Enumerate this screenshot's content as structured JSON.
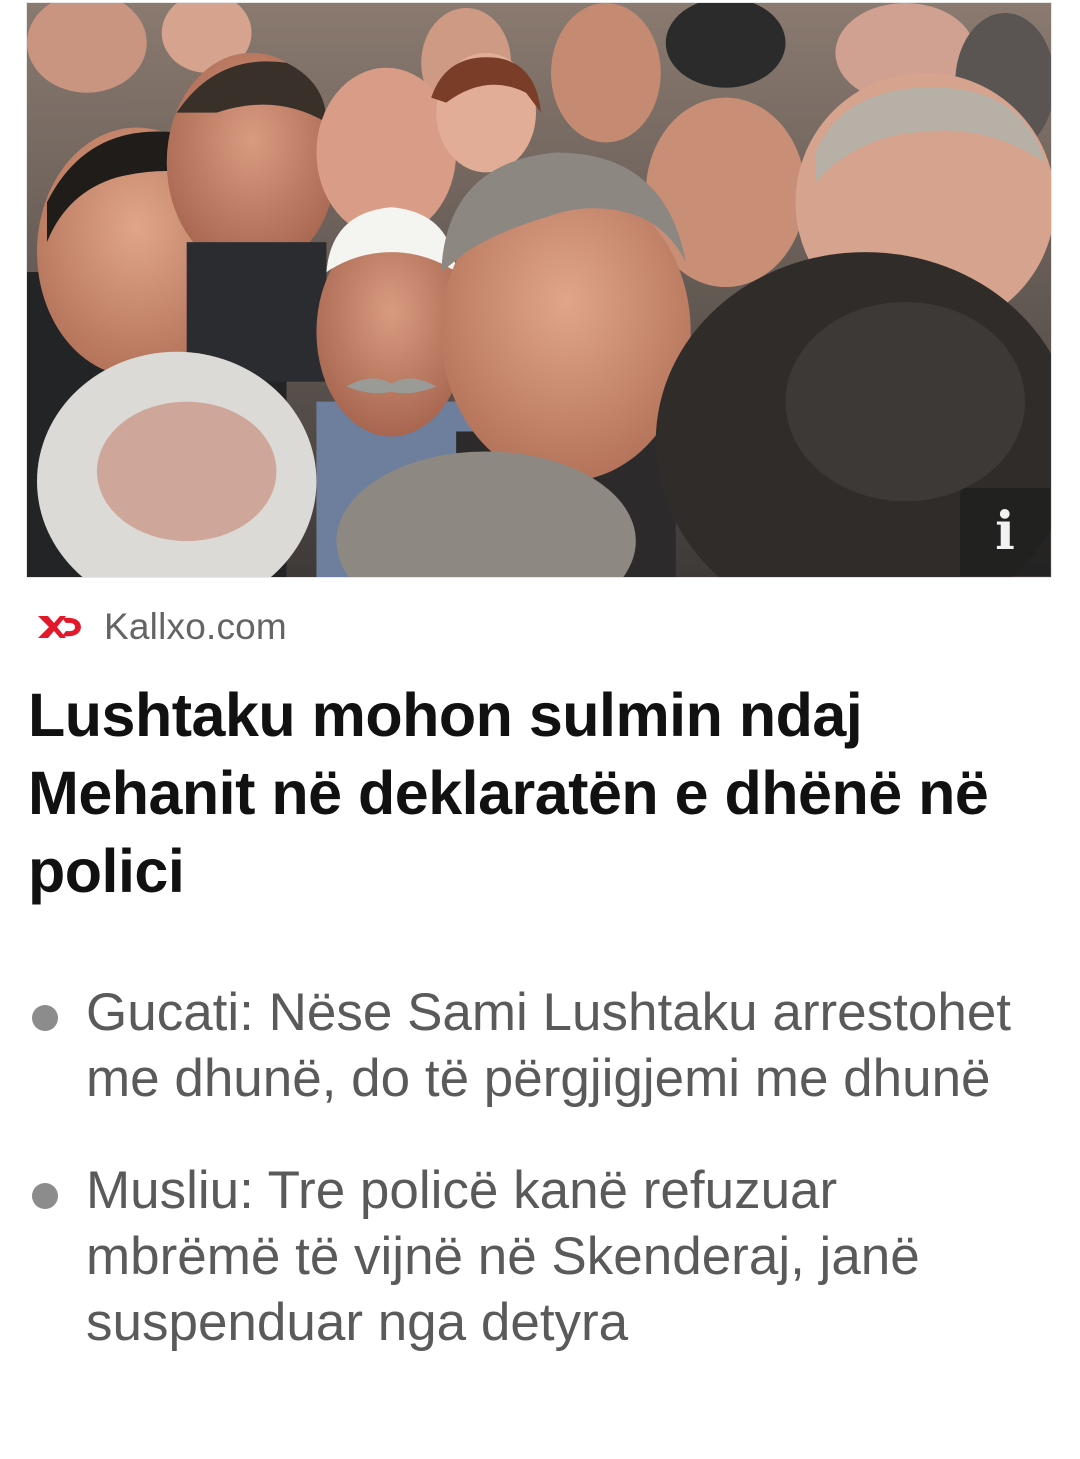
{
  "article": {
    "image_alt": "",
    "info_label": "i",
    "source": {
      "logo_icon": "kallxo-logo-icon",
      "name": "Kallxo.com",
      "brand_color": "#e3192b"
    },
    "headline": "Lushtaku mohon sulmin ndaj Mehanit në deklaratën e dhënë në polici"
  },
  "related_stories": [
    {
      "text": "Gucati: Nëse Sami Lushtaku arrestohet me dhunë, do të përgjigjemi me dhunë"
    },
    {
      "text": "Musliu: Tre policë kanë refuzuar mbrëmë të vijnë në Skenderaj, janë suspenduar nga detyra"
    }
  ],
  "colors": {
    "headline": "#111111",
    "source_text": "#646464",
    "related_text": "#5a5a5a",
    "bullet": "#8c8c8c"
  }
}
